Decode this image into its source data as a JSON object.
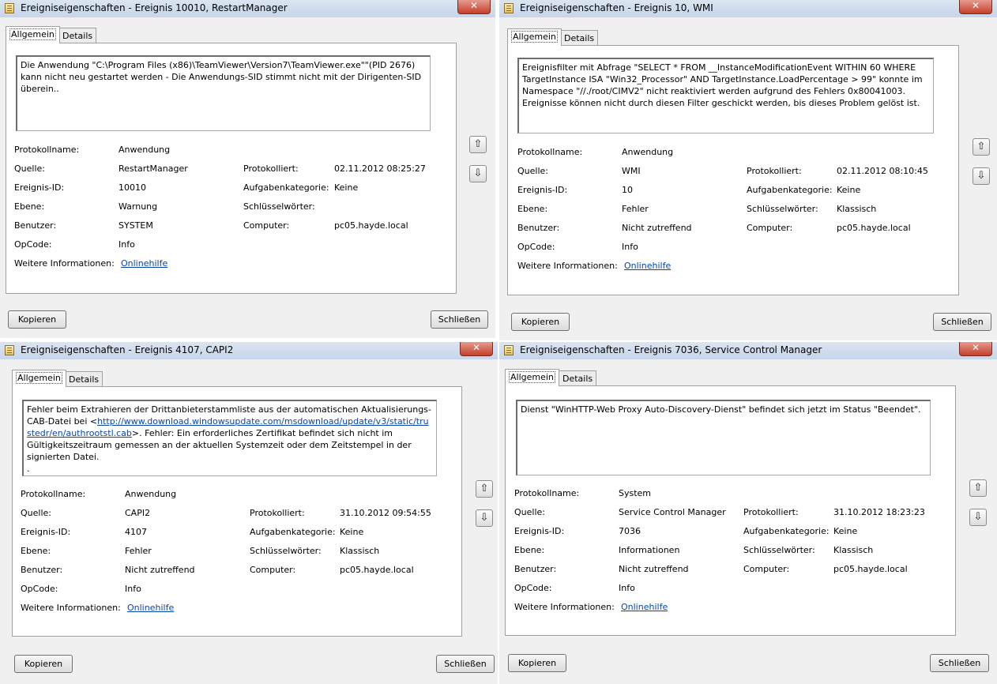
{
  "windows": [
    {
      "title": "Ereigniseigenschaften - Ereignis 10010, RestartManager",
      "tabs": [
        "Allgemein",
        "Details"
      ],
      "message": "Die Anwendung \"C:\\Program Files (x86)\\TeamViewer\\Version7\\TeamViewer.exe\"\"(PID 2676) kann nicht neu gestartet werden - Die Anwendungs-SID stimmt nicht mit der Dirigenten-SID überein..",
      "labels": {
        "log": "Protokollname:",
        "source": "Quelle:",
        "event_id": "Ereignis-ID:",
        "level": "Ebene:",
        "user": "Benutzer:",
        "opcode": "OpCode:",
        "more_info": "Weitere Informationen:",
        "logged": "Protokolliert:",
        "task": "Aufgabenkategorie:",
        "keywords": "Schlüsselwörter:",
        "computer": "Computer:"
      },
      "values": {
        "log": "Anwendung",
        "source": "RestartManager",
        "event_id": "10010",
        "level": "Warnung",
        "user": "SYSTEM",
        "opcode": "Info",
        "more_info": "Onlinehilfe",
        "logged": "02.11.2012 08:25:27",
        "task": "Keine",
        "keywords": "",
        "computer": "pc05.hayde.local"
      },
      "buttons": {
        "copy": "Kopieren",
        "close": "Schließen",
        "up": "⇧",
        "down": "⇩",
        "x": "✕"
      }
    },
    {
      "title": "Ereigniseigenschaften - Ereignis 10, WMI",
      "tabs": [
        "Allgemein",
        "Details"
      ],
      "message": "Ereignisfilter mit Abfrage \"SELECT * FROM __InstanceModificationEvent WITHIN 60 WHERE TargetInstance ISA \"Win32_Processor\" AND TargetInstance.LoadPercentage > 99\" konnte im Namespace \"//./root/CIMV2\" nicht reaktiviert werden aufgrund des Fehlers 0x80041003. Ereignisse können nicht durch diesen Filter geschickt werden, bis dieses Problem gelöst ist.",
      "labels": {
        "log": "Protokollname:",
        "source": "Quelle:",
        "event_id": "Ereignis-ID:",
        "level": "Ebene:",
        "user": "Benutzer:",
        "opcode": "OpCode:",
        "more_info": "Weitere Informationen:",
        "logged": "Protokolliert:",
        "task": "Aufgabenkategorie:",
        "keywords": "Schlüsselwörter:",
        "computer": "Computer:"
      },
      "values": {
        "log": "Anwendung",
        "source": "WMI",
        "event_id": "10",
        "level": "Fehler",
        "user": "Nicht zutreffend",
        "opcode": "Info",
        "more_info": "Onlinehilfe",
        "logged": "02.11.2012 08:10:45",
        "task": "Keine",
        "keywords": "Klassisch",
        "computer": "pc05.hayde.local"
      },
      "buttons": {
        "copy": "Kopieren",
        "close": "Schließen",
        "up": "⇧",
        "down": "⇩",
        "x": "✕"
      }
    },
    {
      "title": "Ereigniseigenschaften - Ereignis 4107, CAPI2",
      "tabs": [
        "Allgemein",
        "Details"
      ],
      "message_pre": "Fehler beim Extrahieren der Drittanbieterstammliste aus der automatischen Aktualisierungs-CAB-Datei bei <",
      "message_link": "http://www.download.windowsupdate.com/msdownload/update/v3/static/trustedr/en/authrootstl.cab",
      "message_post": ">. Fehler: Ein erforderliches Zertifikat befindet sich nicht im Gültigkeitszeitraum gemessen an der aktuellen Systemzeit oder dem Zeitstempel in der signierten Datei.",
      "message_end": ".",
      "labels": {
        "log": "Protokollname:",
        "source": "Quelle:",
        "event_id": "Ereignis-ID:",
        "level": "Ebene:",
        "user": "Benutzer:",
        "opcode": "OpCode:",
        "more_info": "Weitere Informationen:",
        "logged": "Protokolliert:",
        "task": "Aufgabenkategorie:",
        "keywords": "Schlüsselwörter:",
        "computer": "Computer:"
      },
      "values": {
        "log": "Anwendung",
        "source": "CAPI2",
        "event_id": "4107",
        "level": "Fehler",
        "user": "Nicht zutreffend",
        "opcode": "Info",
        "more_info": "Onlinehilfe",
        "logged": "31.10.2012 09:54:55",
        "task": "Keine",
        "keywords": "Klassisch",
        "computer": "pc05.hayde.local"
      },
      "buttons": {
        "copy": "Kopieren",
        "close": "Schließen",
        "up": "⇧",
        "down": "⇩",
        "x": "✕"
      }
    },
    {
      "title": "Ereigniseigenschaften - Ereignis 7036, Service Control Manager",
      "tabs": [
        "Allgemein",
        "Details"
      ],
      "message": "Dienst \"WinHTTP-Web Proxy Auto-Discovery-Dienst\" befindet sich jetzt im Status \"Beendet\".",
      "labels": {
        "log": "Protokollname:",
        "source": "Quelle:",
        "event_id": "Ereignis-ID:",
        "level": "Ebene:",
        "user": "Benutzer:",
        "opcode": "OpCode:",
        "more_info": "Weitere Informationen:",
        "logged": "Protokolliert:",
        "task": "Aufgabenkategorie:",
        "keywords": "Schlüsselwörter:",
        "computer": "Computer:"
      },
      "values": {
        "log": "System",
        "source": "Service Control Manager",
        "event_id": "7036",
        "level": "Informationen",
        "user": "Nicht zutreffend",
        "opcode": "Info",
        "more_info": "Onlinehilfe",
        "logged": "31.10.2012 18:23:23",
        "task": "Keine",
        "keywords": "Klassisch",
        "computer": "pc05.hayde.local"
      },
      "buttons": {
        "copy": "Kopieren",
        "close": "Schließen",
        "up": "⇧",
        "down": "⇩",
        "x": "✕"
      }
    }
  ],
  "colors": {
    "link": "#0645ad",
    "close_button": "#c4402b",
    "titlebar": "#c6d5ea"
  }
}
